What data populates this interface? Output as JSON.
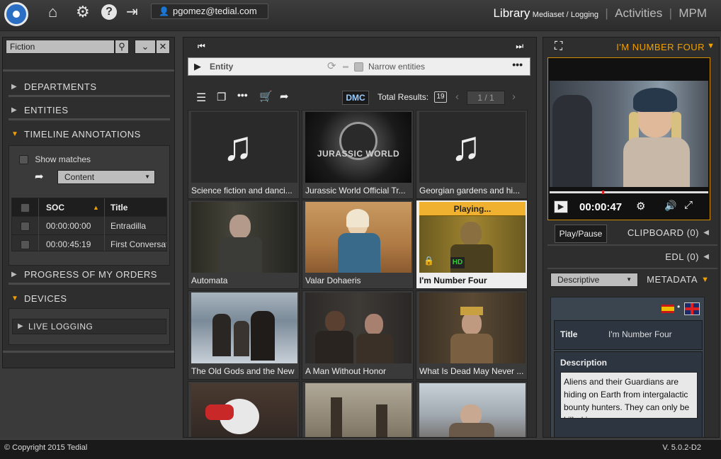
{
  "header": {
    "user_email": "pgomez@tedial.com",
    "nav": {
      "library": "Library",
      "mediaset": "Mediaset /",
      "logging": "Logging",
      "separator": "|",
      "activities": "Activities",
      "mpm": "MPM"
    }
  },
  "left": {
    "search_value": "Fiction",
    "sections": {
      "departments": "DEPARTMENTS",
      "entities": "ENTITIES",
      "timeline_annotations": "TIMELINE ANNOTATIONS",
      "progress": "PROGRESS OF MY ORDERS",
      "devices": "DEVICES"
    },
    "show_matches": "Show matches",
    "content_select": "Content",
    "table": {
      "headers": {
        "soc": "SOC",
        "title": "Title"
      },
      "rows": [
        {
          "soc": "00:00:00:00",
          "title": "Entradilla"
        },
        {
          "soc": "00:00:45:19",
          "title": "First Conversati"
        }
      ]
    },
    "live_logging": "LIVE LOGGING"
  },
  "center": {
    "entity_label": "Entity",
    "narrow_label": "Narrow entities",
    "dmc_label": "DMC",
    "total_results_label": "Total Results:",
    "total_results": "19",
    "page_indicator": "1 / 1",
    "tiles": [
      {
        "caption": "Science fiction and danci...",
        "kind": "audio"
      },
      {
        "caption": "Jurassic World Official Tr...",
        "kind": "jurassic"
      },
      {
        "caption": "Georgian gardens and hi...",
        "kind": "audio"
      },
      {
        "caption": "Automata",
        "kind": "automata"
      },
      {
        "caption": "Valar Dohaeris",
        "kind": "valar"
      },
      {
        "caption": "I'm Number Four",
        "kind": "playing",
        "playing_label": "Playing...",
        "hd_label": "HD"
      },
      {
        "caption": "The Old Gods and the New",
        "kind": "oldgods"
      },
      {
        "caption": "A Man Without Honor",
        "kind": "manwithout"
      },
      {
        "caption": "What Is Dead May Never ...",
        "kind": "whatisdead"
      },
      {
        "caption": "",
        "kind": "bird"
      },
      {
        "caption": "",
        "kind": "desert"
      },
      {
        "caption": "",
        "kind": "lady"
      }
    ],
    "jurassic_logo": "JURASSIC WORLD"
  },
  "right": {
    "player_title": "I'M NUMBER FOUR",
    "timecode": "00:00:47",
    "play_pause_tooltip": "Play/Pause",
    "clipboard": "CLIPBOARD (0)",
    "edl": "EDL (0)",
    "descriptive_select": "Descriptive",
    "metadata": "METADATA",
    "meta_title_label": "Title",
    "meta_title_value": "I'm Number Four",
    "meta_desc_label": "Description",
    "meta_desc_value": "Aliens and their Guardians are hiding on Earth from intergalactic bounty hunters. They can only be killed in"
  },
  "footer": {
    "copyright": "© Copyright 2015 Tedial",
    "version": "V. 5.0.2-D2"
  }
}
